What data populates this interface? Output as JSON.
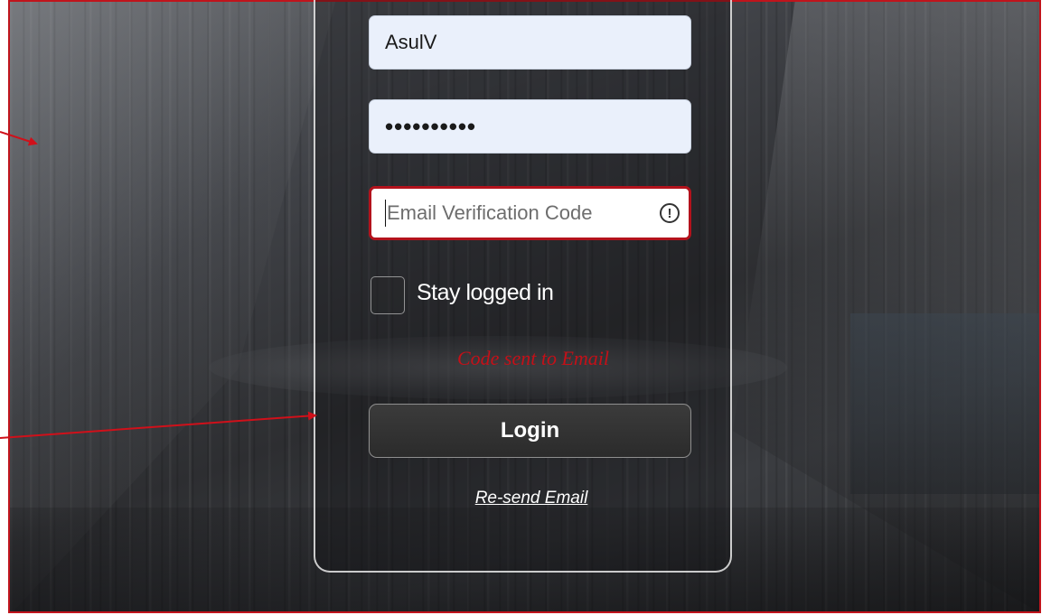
{
  "form": {
    "username_value": "AsulV",
    "password_value": "••••••••••",
    "code_placeholder": "Email Verification Code",
    "warning_icon": "exclamation-circle-icon",
    "stay_logged_in_label": "Stay logged in",
    "stay_logged_in_checked": false,
    "status_message": "Code sent to Email",
    "login_label": "Login",
    "resend_label": "Re-send Email"
  },
  "colors": {
    "frame_border": "#c0141c",
    "error_border": "#b3121c",
    "status_text": "#c41018",
    "annotation_arrow": "#d0101a"
  }
}
